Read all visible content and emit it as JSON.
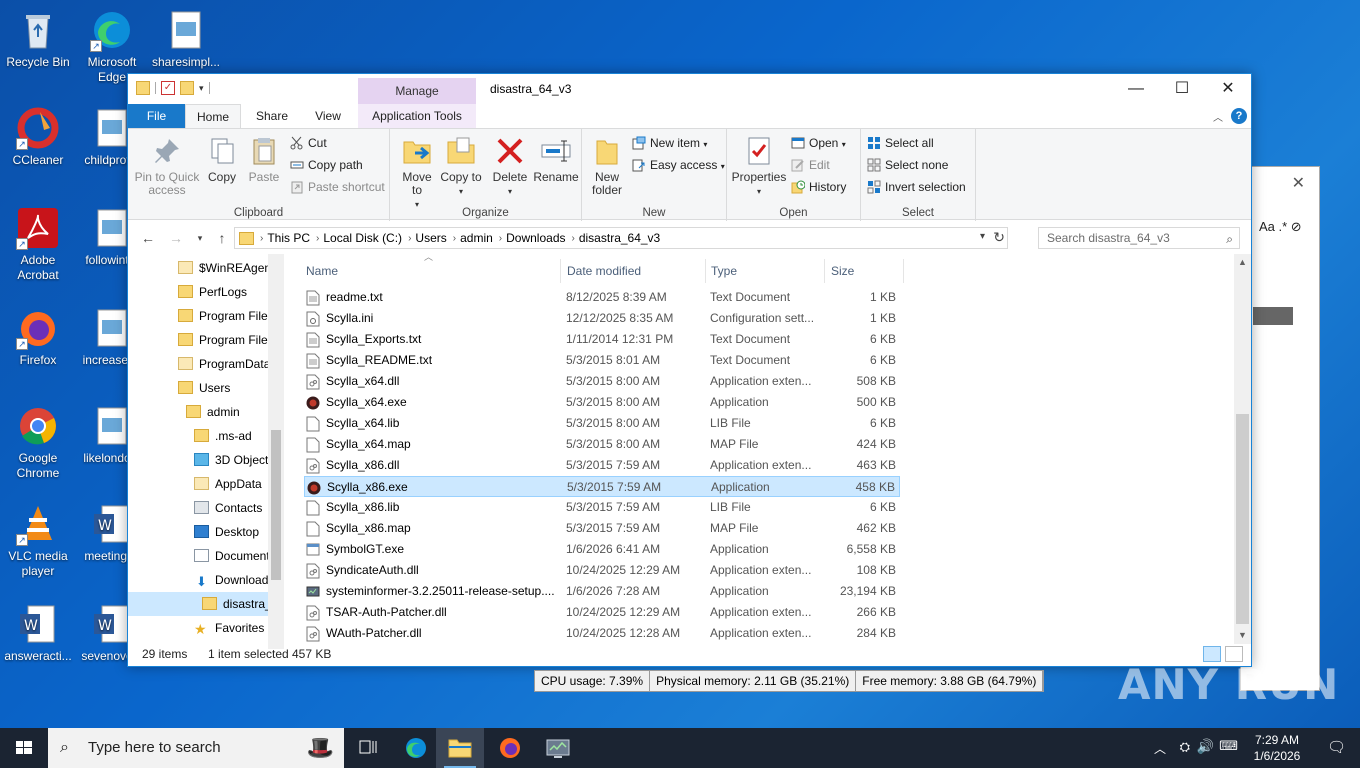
{
  "desktop": {
    "icons": [
      {
        "label": "Recycle Bin"
      },
      {
        "label": "Microsoft Edge"
      },
      {
        "label": "sharesimpl..."
      },
      {
        "label": "CCleaner"
      },
      {
        "label": "childprof..."
      },
      {
        "label": "Adobe Acrobat"
      },
      {
        "label": "followint..."
      },
      {
        "label": "Firefox"
      },
      {
        "label": "increaser..."
      },
      {
        "label": "Google Chrome"
      },
      {
        "label": "likelondo..."
      },
      {
        "label": "VLC media player"
      },
      {
        "label": "meetingl..."
      },
      {
        "label": "answeracti..."
      },
      {
        "label": "sevenove..."
      }
    ]
  },
  "window": {
    "title": "disastra_64_v3",
    "manage_label": "Manage",
    "tabs": {
      "file": "File",
      "home": "Home",
      "share": "Share",
      "view": "View",
      "app_tools": "Application Tools"
    }
  },
  "ribbon": {
    "clipboard": {
      "group": "Clipboard",
      "pin": "Pin to Quick access",
      "copy": "Copy",
      "paste": "Paste",
      "cut": "Cut",
      "copy_path": "Copy path",
      "paste_shortcut": "Paste shortcut"
    },
    "organize": {
      "group": "Organize",
      "move_to": "Move to",
      "copy_to": "Copy to",
      "delete": "Delete",
      "rename": "Rename"
    },
    "new": {
      "group": "New",
      "new_folder": "New folder",
      "new_item": "New item",
      "easy_access": "Easy access"
    },
    "open": {
      "group": "Open",
      "properties": "Properties",
      "open": "Open",
      "edit": "Edit",
      "history": "History"
    },
    "select": {
      "group": "Select",
      "select_all": "Select all",
      "select_none": "Select none",
      "invert": "Invert selection"
    }
  },
  "address": {
    "crumbs": [
      "This PC",
      "Local Disk (C:)",
      "Users",
      "admin",
      "Downloads",
      "disastra_64_v3"
    ],
    "search_placeholder": "Search disastra_64_v3"
  },
  "nav": [
    {
      "label": "$WinREAgent"
    },
    {
      "label": "PerfLogs"
    },
    {
      "label": "Program Files"
    },
    {
      "label": "Program Files"
    },
    {
      "label": "ProgramData"
    },
    {
      "label": "Users"
    },
    {
      "label": "admin"
    },
    {
      "label": ".ms-ad"
    },
    {
      "label": "3D Objects"
    },
    {
      "label": "AppData"
    },
    {
      "label": "Contacts"
    },
    {
      "label": "Desktop"
    },
    {
      "label": "Documents"
    },
    {
      "label": "Downloads"
    },
    {
      "label": "disastra_"
    },
    {
      "label": "Favorites"
    }
  ],
  "columns": {
    "name": "Name",
    "date": "Date modified",
    "type": "Type",
    "size": "Size"
  },
  "files": [
    {
      "name": "readme.txt",
      "date": "8/12/2025 8:39 AM",
      "type": "Text Document",
      "size": "1 KB",
      "icon": "doc-icon"
    },
    {
      "name": "Scylla.ini",
      "date": "12/12/2025 8:35 AM",
      "type": "Configuration sett...",
      "size": "1 KB",
      "icon": "ini-icon"
    },
    {
      "name": "Scylla_Exports.txt",
      "date": "1/11/2014 12:31 PM",
      "type": "Text Document",
      "size": "6 KB",
      "icon": "doc-icon"
    },
    {
      "name": "Scylla_README.txt",
      "date": "5/3/2015 8:01 AM",
      "type": "Text Document",
      "size": "6 KB",
      "icon": "doc-icon"
    },
    {
      "name": "Scylla_x64.dll",
      "date": "5/3/2015 8:00 AM",
      "type": "Application exten...",
      "size": "508 KB",
      "icon": "dll-icon"
    },
    {
      "name": "Scylla_x64.exe",
      "date": "5/3/2015 8:00 AM",
      "type": "Application",
      "size": "500 KB",
      "icon": "scylla-icon"
    },
    {
      "name": "Scylla_x64.lib",
      "date": "5/3/2015 8:00 AM",
      "type": "LIB File",
      "size": "6 KB",
      "icon": "blank-icon"
    },
    {
      "name": "Scylla_x64.map",
      "date": "5/3/2015 8:00 AM",
      "type": "MAP File",
      "size": "424 KB",
      "icon": "blank-icon"
    },
    {
      "name": "Scylla_x86.dll",
      "date": "5/3/2015 7:59 AM",
      "type": "Application exten...",
      "size": "463 KB",
      "icon": "dll-icon"
    },
    {
      "name": "Scylla_x86.exe",
      "date": "5/3/2015 7:59 AM",
      "type": "Application",
      "size": "458 KB",
      "icon": "scylla-icon",
      "selected": true
    },
    {
      "name": "Scylla_x86.lib",
      "date": "5/3/2015 7:59 AM",
      "type": "LIB File",
      "size": "6 KB",
      "icon": "blank-icon"
    },
    {
      "name": "Scylla_x86.map",
      "date": "5/3/2015 7:59 AM",
      "type": "MAP File",
      "size": "462 KB",
      "icon": "blank-icon"
    },
    {
      "name": "SymbolGT.exe",
      "date": "1/6/2026 6:41 AM",
      "type": "Application",
      "size": "6,558 KB",
      "icon": "exe-icon"
    },
    {
      "name": "SyndicateAuth.dll",
      "date": "10/24/2025 12:29 AM",
      "type": "Application exten...",
      "size": "108 KB",
      "icon": "dll-icon"
    },
    {
      "name": "systeminformer-3.2.25011-release-setup....",
      "date": "1/6/2026 7:28 AM",
      "type": "Application",
      "size": "23,194 KB",
      "icon": "setup-icon"
    },
    {
      "name": "TSAR-Auth-Patcher.dll",
      "date": "10/24/2025 12:29 AM",
      "type": "Application exten...",
      "size": "266 KB",
      "icon": "dll-icon"
    },
    {
      "name": "WAuth-Patcher.dll",
      "date": "10/24/2025 12:28 AM",
      "type": "Application exten...",
      "size": "284 KB",
      "icon": "dll-icon"
    }
  ],
  "status": {
    "count": "29 items",
    "selected": "1 item selected",
    "size": "457 KB"
  },
  "perf": {
    "cpu": "CPU usage: 7.39%",
    "phys": "Physical memory: 2.11 GB (35.21%)",
    "free": "Free memory: 3.88 GB (64.79%)"
  },
  "watermark": "ANY RUN",
  "taskbar": {
    "search_placeholder": "Type here to search",
    "time": "7:29 AM",
    "date": "1/6/2026"
  }
}
